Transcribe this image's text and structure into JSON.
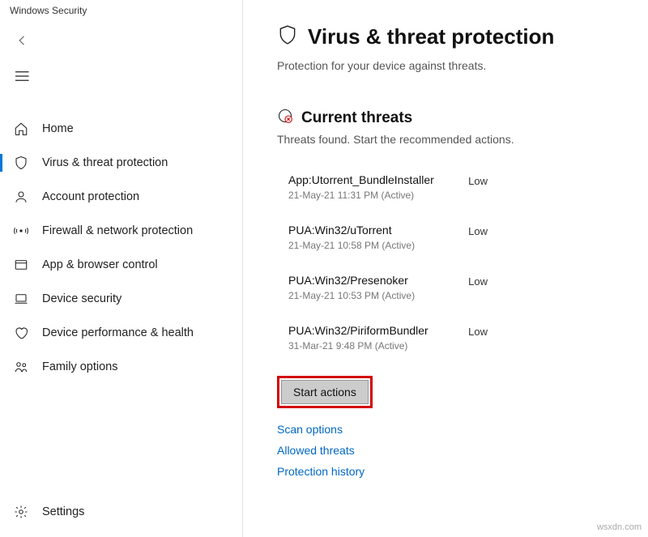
{
  "app": {
    "title": "Windows Security"
  },
  "sidebar": {
    "items": [
      {
        "label": "Home"
      },
      {
        "label": "Virus & threat protection"
      },
      {
        "label": "Account protection"
      },
      {
        "label": "Firewall & network protection"
      },
      {
        "label": "App & browser control"
      },
      {
        "label": "Device security"
      },
      {
        "label": "Device performance & health"
      },
      {
        "label": "Family options"
      }
    ],
    "settings_label": "Settings"
  },
  "page": {
    "title": "Virus & threat protection",
    "subtitle": "Protection for your device against threats."
  },
  "current_threats": {
    "title": "Current threats",
    "subtitle": "Threats found. Start the recommended actions.",
    "items": [
      {
        "name": "App:Utorrent_BundleInstaller",
        "meta": "21-May-21 11:31 PM (Active)",
        "severity": "Low"
      },
      {
        "name": "PUA:Win32/uTorrent",
        "meta": "21-May-21 10:58 PM (Active)",
        "severity": "Low"
      },
      {
        "name": "PUA:Win32/Presenoker",
        "meta": "21-May-21 10:53 PM (Active)",
        "severity": "Low"
      },
      {
        "name": "PUA:Win32/PiriformBundler",
        "meta": "31-Mar-21 9:48 PM (Active)",
        "severity": "Low"
      }
    ],
    "start_actions_label": "Start actions"
  },
  "links": {
    "scan_options": "Scan options",
    "allowed_threats": "Allowed threats",
    "protection_history": "Protection history"
  },
  "watermark": "wsxdn.com"
}
